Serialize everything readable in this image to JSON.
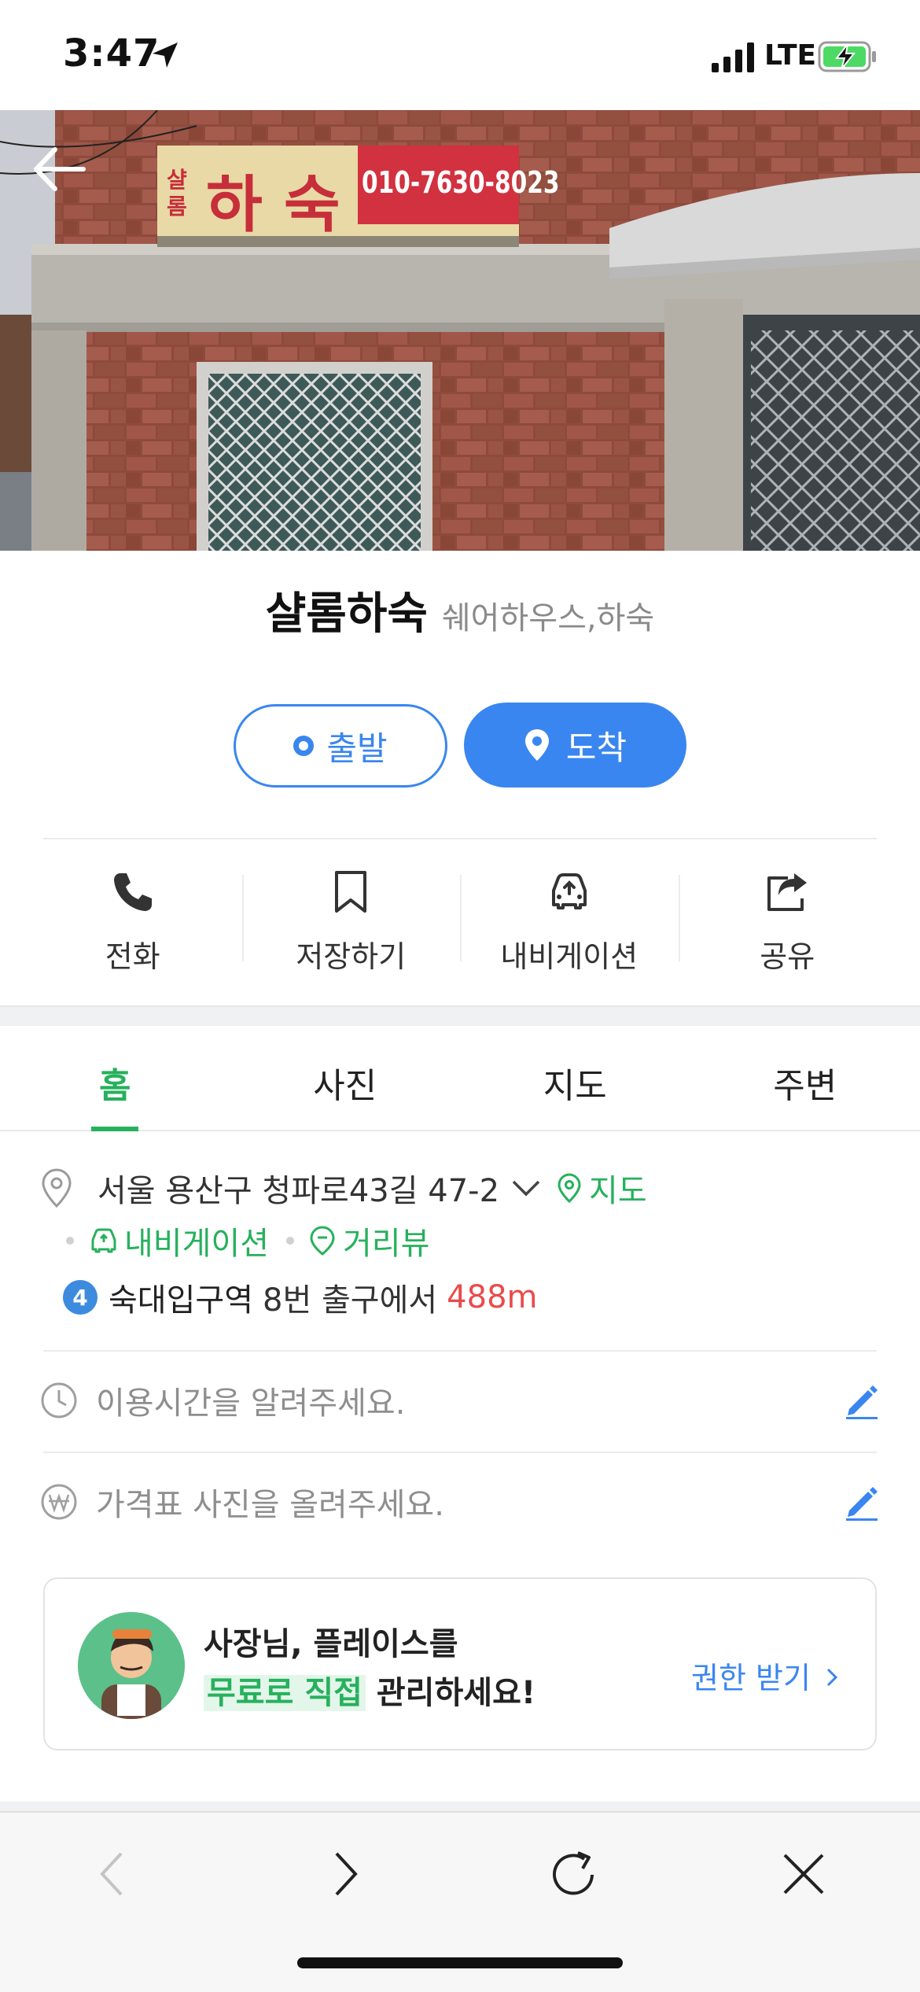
{
  "status_bar": {
    "time": "3:47",
    "network": "LTE"
  },
  "place": {
    "name": "샬롬하숙",
    "category": "쉐어하우스,하숙"
  },
  "sign": {
    "text": "하 숙",
    "small": "샬\n롬",
    "phone": "010-7630-8023"
  },
  "route": {
    "start_label": "출발",
    "arrive_label": "도착"
  },
  "actions": [
    {
      "label": "전화",
      "icon": "phone-icon"
    },
    {
      "label": "저장하기",
      "icon": "bookmark-icon"
    },
    {
      "label": "내비게이션",
      "icon": "car-navigation-icon"
    },
    {
      "label": "공유",
      "icon": "share-icon"
    }
  ],
  "tabs": [
    "홈",
    "사진",
    "지도",
    "주변"
  ],
  "active_tab": "홈",
  "address": {
    "text": "서울 용산구 청파로43길 47-2",
    "map_link": "지도",
    "navigation_link": "내비게이션",
    "street_view_link": "거리뷰",
    "subway_line": "4",
    "station": "숙대입구역",
    "exit_text": "8번 출구에서",
    "distance": "488m"
  },
  "hours_prompt": "이용시간을 알려주세요.",
  "price_prompt": "가격표 사진을 올려주세요.",
  "owner_card": {
    "line1": "사장님, 플레이스를",
    "line2_highlight": "무료로 직접",
    "line2_rest": " 관리하세요!",
    "cta": "권한 받기"
  },
  "colors": {
    "accent_blue": "#3a86f0",
    "accent_green": "#26b15c",
    "distance_red": "#ea4b4b"
  }
}
